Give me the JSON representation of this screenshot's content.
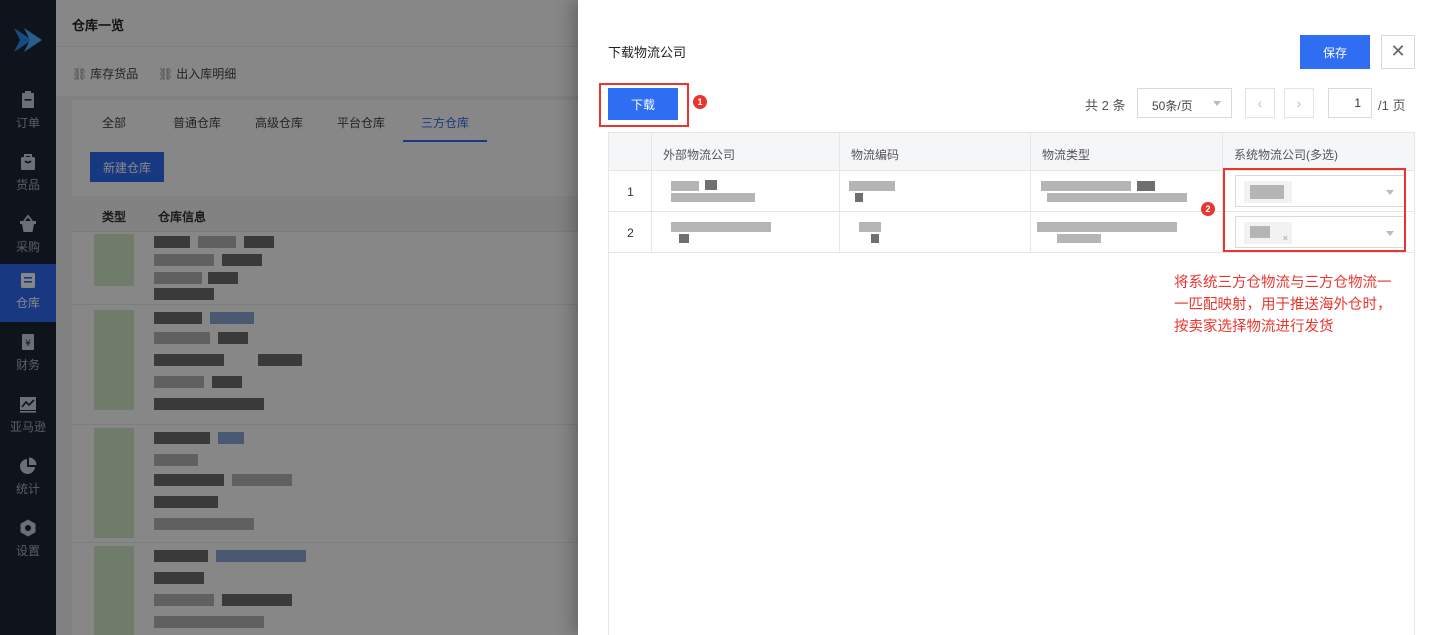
{
  "nav": {
    "items": [
      {
        "label": "订单",
        "icon": "order-icon"
      },
      {
        "label": "货品",
        "icon": "goods-icon"
      },
      {
        "label": "采购",
        "icon": "basket-icon"
      },
      {
        "label": "仓库",
        "icon": "warehouse-icon",
        "active": true
      },
      {
        "label": "财务",
        "icon": "finance-icon"
      },
      {
        "label": "亚马逊",
        "icon": "chart-line-icon"
      },
      {
        "label": "统计",
        "icon": "pie-chart-icon"
      },
      {
        "label": "设置",
        "icon": "settings-icon"
      }
    ]
  },
  "page": {
    "title": "仓库一览",
    "quick_links": [
      "库存货品",
      "出入库明细"
    ],
    "tabs": [
      "全部",
      "普通仓库",
      "高级仓库",
      "平台仓库",
      "三方仓库"
    ],
    "active_tab": "三方仓库",
    "new_button": "新建仓库",
    "columns": [
      "类型",
      "仓库信息"
    ]
  },
  "drawer": {
    "title": "下载物流公司",
    "save_label": "保存",
    "close_symbol": "✕",
    "download_label": "下载",
    "badge1": "1",
    "badge2": "2",
    "pagination": {
      "total": "共 2 条",
      "page_size": "50条/页",
      "prev": "‹",
      "next": "›",
      "current_page": "1",
      "total_pages": "/1 页"
    },
    "table": {
      "headers": [
        "外部物流公司",
        "物流编码",
        "物流类型",
        "系统物流公司(多选)"
      ],
      "rows": [
        {
          "index": "1"
        },
        {
          "index": "2"
        }
      ]
    },
    "annotation": "将系统三方仓物流与三方仓物流一一匹配映射，用于推送海外仓时，按卖家选择物流进行发货",
    "accent": "#2f6df3",
    "highlight": "#e8362f"
  }
}
